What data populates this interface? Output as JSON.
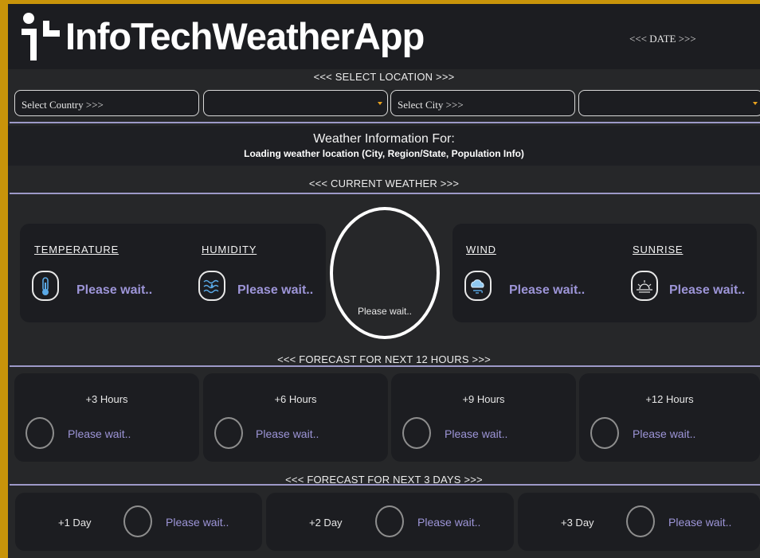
{
  "header": {
    "app_title": "InfoTechWeatherApp",
    "date": "<<< DATE >>>"
  },
  "location": {
    "section_title": "<<< SELECT LOCATION >>>",
    "country_label": "Select Country >>>",
    "country_value": "",
    "city_label": "Select City >>>",
    "city_value": ""
  },
  "info": {
    "title": "Weather Information For:",
    "subtitle": "Loading weather location (City, Region/State, Population Info)"
  },
  "current": {
    "section_title": "<<< CURRENT WEATHER >>>",
    "temperature": {
      "label": "TEMPERATURE",
      "value": "Please wait..",
      "icon": "thermometer-icon"
    },
    "humidity": {
      "label": "HUMIDITY",
      "value": "Please wait..",
      "icon": "humidity-icon"
    },
    "wind": {
      "label": "WIND",
      "value": "Please wait..",
      "icon": "wind-cloud-icon"
    },
    "sunrise": {
      "label": "SUNRISE",
      "value": "Please wait..",
      "icon": "sunrise-icon"
    },
    "main_status": "Please wait.."
  },
  "hourly": {
    "section_title": "<<< FORECAST FOR NEXT 12 HOURS >>>",
    "items": [
      {
        "label": "+3 Hours",
        "value": "Please wait.."
      },
      {
        "label": "+6 Hours",
        "value": "Please wait.."
      },
      {
        "label": "+9 Hours",
        "value": "Please wait.."
      },
      {
        "label": "+12 Hours",
        "value": "Please wait.."
      }
    ]
  },
  "daily": {
    "section_title": "<<< FORECAST FOR NEXT 3 DAYS >>>",
    "items": [
      {
        "label": "+1 Day",
        "value": "Please wait.."
      },
      {
        "label": "+2 Day",
        "value": "Please wait.."
      },
      {
        "label": "+3 Day",
        "value": "Please wait.."
      }
    ]
  },
  "colors": {
    "frame": "#c8940a",
    "accent": "#9d95d8",
    "background": "#262729",
    "panel": "#1c1d21"
  }
}
